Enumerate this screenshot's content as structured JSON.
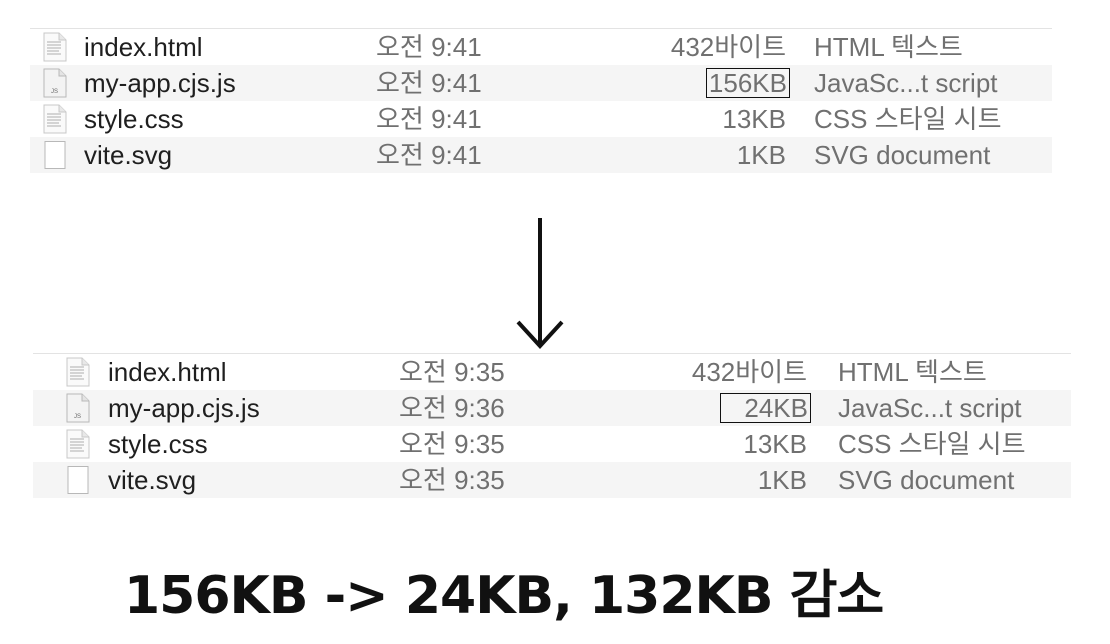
{
  "before": {
    "files": [
      {
        "name": "index.html",
        "date": "오전 9:41",
        "size": "432바이트",
        "kind": "HTML 텍스트",
        "icon": "html-document-icon",
        "highlight": false
      },
      {
        "name": "my-app.cjs.js",
        "date": "오전 9:41",
        "size": "156KB",
        "kind": "JavaSc...t script",
        "icon": "javascript-file-icon",
        "highlight": true
      },
      {
        "name": "style.css",
        "date": "오전 9:41",
        "size": "13KB",
        "kind": "CSS 스타일 시트",
        "icon": "css-document-icon",
        "highlight": false
      },
      {
        "name": "vite.svg",
        "date": "오전 9:41",
        "size": "1KB",
        "kind": "SVG document",
        "icon": "svg-file-icon",
        "highlight": false
      }
    ]
  },
  "after": {
    "files": [
      {
        "name": "index.html",
        "date": "오전 9:35",
        "size": "432바이트",
        "kind": "HTML 텍스트",
        "icon": "html-document-icon",
        "highlight": false
      },
      {
        "name": "my-app.cjs.js",
        "date": "오전 9:36",
        "size": "24KB",
        "kind": "JavaSc...t script",
        "icon": "javascript-file-icon",
        "highlight": true
      },
      {
        "name": "style.css",
        "date": "오전 9:35",
        "size": "13KB",
        "kind": "CSS 스타일 시트",
        "icon": "css-document-icon",
        "highlight": false
      },
      {
        "name": "vite.svg",
        "date": "오전 9:35",
        "size": "1KB",
        "kind": "SVG document",
        "icon": "svg-file-icon",
        "highlight": false
      }
    ]
  },
  "arrow_icon": "down-arrow-icon",
  "summary": "156KB -> 24KB, 132KB 감소"
}
